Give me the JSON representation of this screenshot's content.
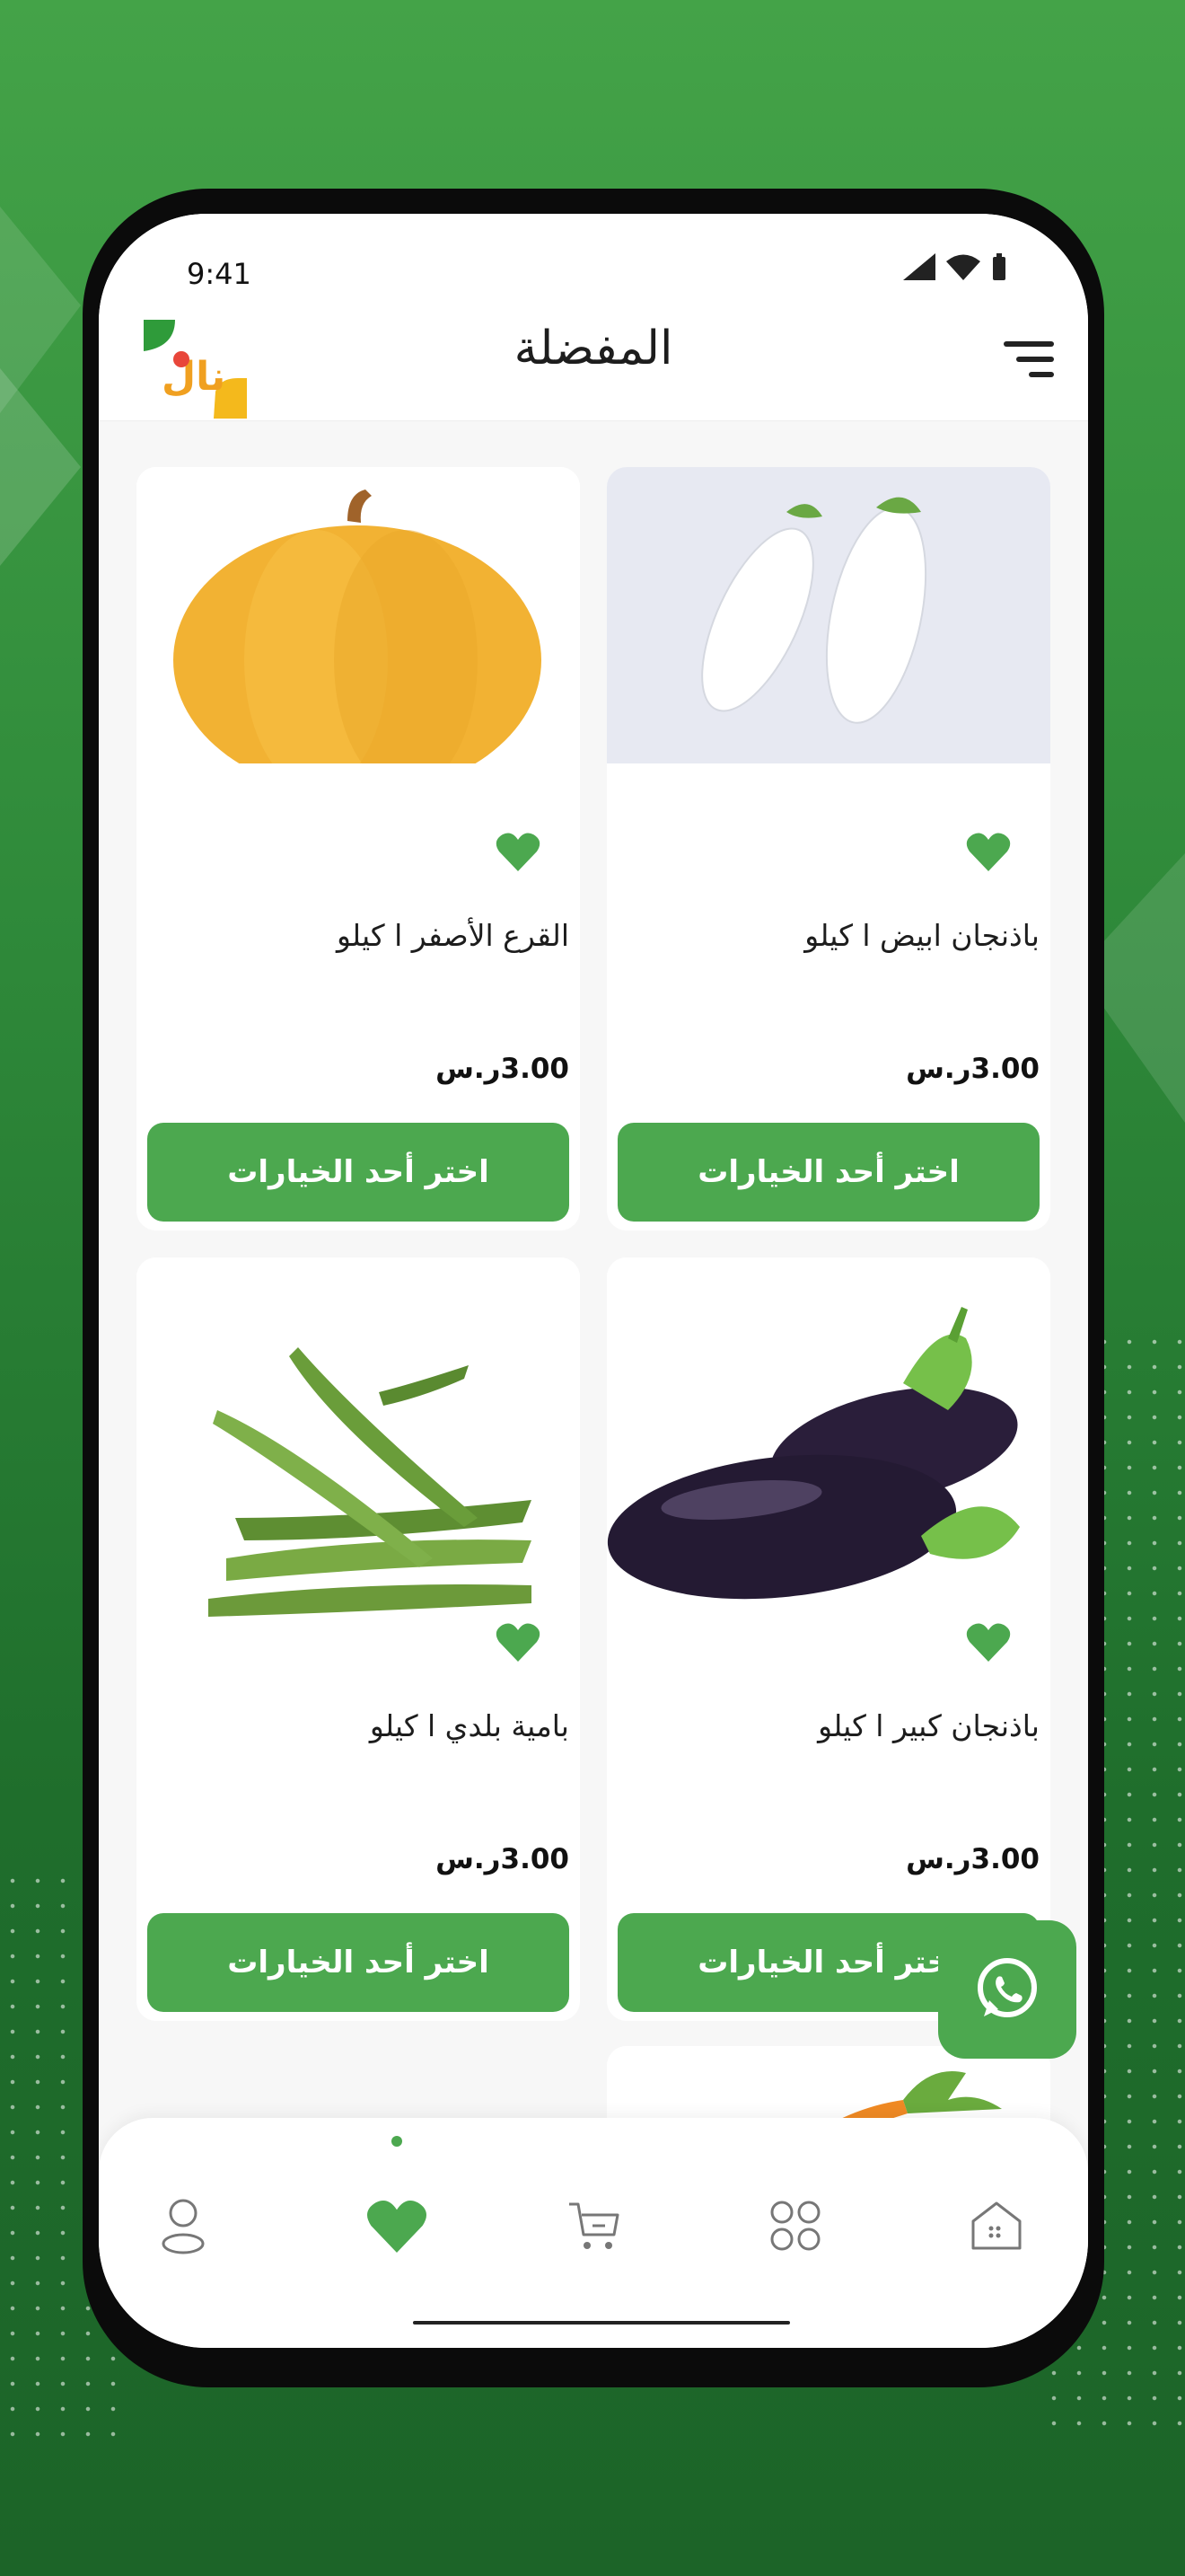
{
  "status_bar": {
    "time": "9:41"
  },
  "header": {
    "title": "المفضلة",
    "logo_text": "نال"
  },
  "products": [
    {
      "name": "باذنجان ابيض ا كيلو",
      "price": "3.00ر.س",
      "button_label": "اختر أحد الخيارات",
      "image": "white-eggplant"
    },
    {
      "name": "القرع الأصفر ا كيلو",
      "price": "3.00ر.س",
      "button_label": "اختر أحد الخيارات",
      "image": "yellow-pumpkin"
    },
    {
      "name": "باذنجان كبير ا كيلو",
      "price": "3.00ر.س",
      "button_label": "اختر أحد الخيارات",
      "image": "purple-eggplant"
    },
    {
      "name": "بامية بلدي ا كيلو",
      "price": "3.00ر.س",
      "button_label": "اختر أحد الخيارات",
      "image": "okra"
    }
  ],
  "nav": {
    "items": [
      "home-icon",
      "categories-icon",
      "cart-icon",
      "favorites-icon",
      "profile-icon"
    ],
    "active": "favorites-icon"
  },
  "colors": {
    "accent": "#4ca84f",
    "background_top": "#44a348",
    "background_bottom": "#1c6428"
  }
}
